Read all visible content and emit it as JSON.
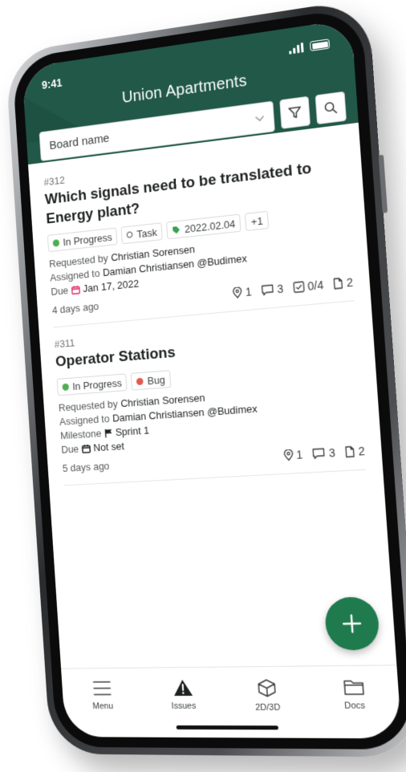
{
  "status_bar": {
    "time": "9:41"
  },
  "header": {
    "title": "Union Apartments",
    "board_placeholder": "Board name",
    "filter_icon": "filter-icon",
    "search_icon": "search-icon"
  },
  "colors": {
    "header": "#215848",
    "fab": "#1f7a4d",
    "in_progress": "#4caf50",
    "bug": "#e05a4f",
    "date_tag": "#36a152"
  },
  "issues": [
    {
      "number": "#312",
      "title": "Which signals need to be translated to Energy plant?",
      "tags": {
        "status": "In Progress",
        "type": "Task",
        "date": "2022.02.04",
        "extra": "+1"
      },
      "requested_label": "Requested by",
      "requested_by": "Christian Sorensen",
      "assigned_label": "Assigned to",
      "assigned_to": "Damian Christiansen @Budimex",
      "due_label": "Due",
      "due": "Jan 17, 2022",
      "ago": "4 days ago",
      "stats": {
        "locations": "1",
        "comments": "3",
        "checklist": "0/4",
        "docs": "2"
      }
    },
    {
      "number": "#311",
      "title": "Operator Stations",
      "tags": {
        "status": "In Progress",
        "type": "Bug"
      },
      "requested_label": "Requested by",
      "requested_by": "Christian Sorensen",
      "assigned_label": "Assigned to",
      "assigned_to": "Damian Christiansen @Budimex",
      "milestone_label": "Milestone",
      "milestone": "Sprint 1",
      "due_label": "Due",
      "due": "Not set",
      "ago": "5 days ago",
      "stats": {
        "locations": "1",
        "comments": "3",
        "docs": "2"
      }
    }
  ],
  "fab": {
    "icon": "plus-icon"
  },
  "nav": [
    {
      "label": "Menu",
      "icon": "menu-icon"
    },
    {
      "label": "Issues",
      "icon": "warning-icon"
    },
    {
      "label": "2D/3D",
      "icon": "cube-icon"
    },
    {
      "label": "Docs",
      "icon": "folder-icon"
    }
  ]
}
